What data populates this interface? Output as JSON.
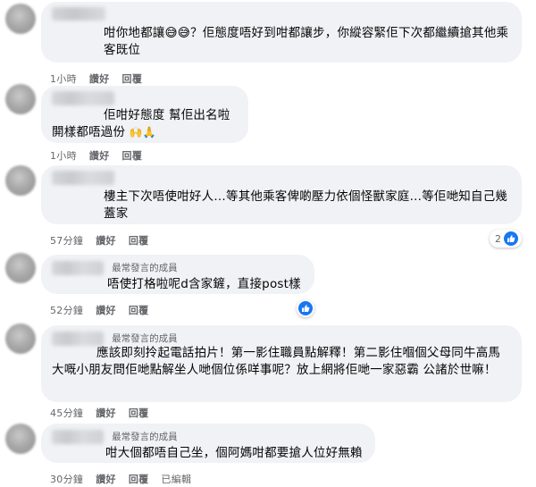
{
  "comments": [
    {
      "text": "咁你地都讓😅😅？佢態度唔好到咁都讓步，你縱容緊佢下次都繼續搶其他乘客既位",
      "time": "1小時",
      "like": "讚好",
      "reply": "回覆"
    },
    {
      "text_line1": "佢咁好態度 幫佢出名啦",
      "text_line2": "閞樣都唔過份",
      "emoji": "🙌🙏",
      "time": "1小時",
      "like": "讚好",
      "reply": "回覆"
    },
    {
      "text": "樓主下次唔使咁好人…等其他乘客俾啲壓力依個怪獸家庭…等佢哋知自己幾蓋家",
      "time": "57分鐘",
      "like": "讚好",
      "reply": "回覆",
      "reaction_count": "2"
    },
    {
      "badge": "最常發言的成員",
      "text": "唔使打格啦呢d含家鏟，直接post樣",
      "time": "52分鐘",
      "like": "讚好",
      "reply": "回覆"
    },
    {
      "badge": "最常發言的成員",
      "text": "應該即刻拎起電話拍片！第一影住職員點解釋！第二影住嗰個父母同牛高馬大嘅小朋友問佢哋點解坐人哋個位係咩事呢？放上網將佢哋一家惡霸 公諸於世嘛！",
      "time": "45分鐘",
      "like": "讚好",
      "reply": "回覆"
    },
    {
      "badge": "最常發言的成員",
      "text": "咁大個都唔自己坐，個阿媽咁都要搶人位好無賴",
      "time": "30分鐘",
      "like": "讚好",
      "reply": "回覆",
      "edited": "已編輯"
    }
  ]
}
